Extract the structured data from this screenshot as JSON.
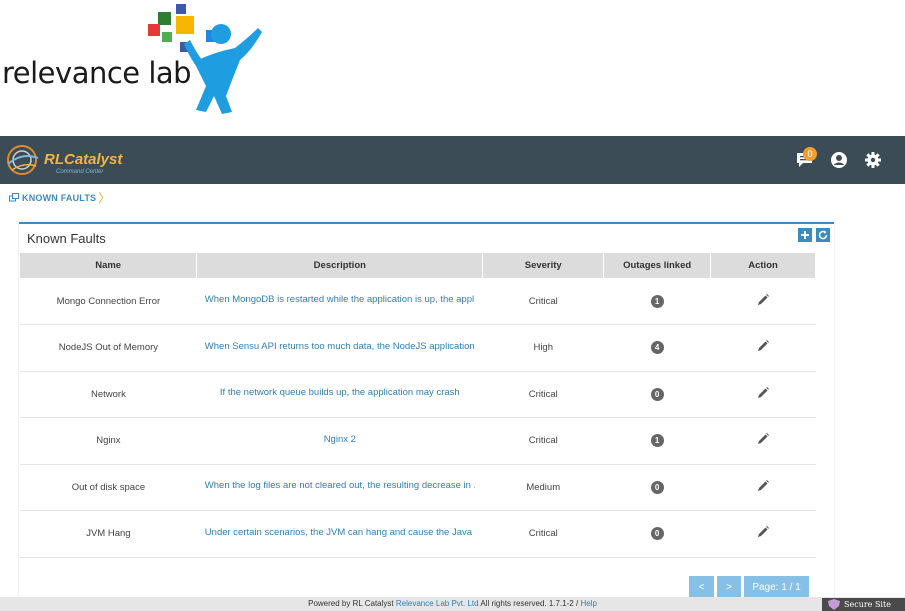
{
  "logo": {
    "text": "relevance lab"
  },
  "navbar": {
    "brand_name": "RLCatalyst",
    "brand_sub": "Command Center",
    "notification_count": "0"
  },
  "breadcrumb": {
    "label": "KNOWN FAULTS"
  },
  "panel": {
    "title": "Known Faults",
    "columns": [
      "Name",
      "Description",
      "Severity",
      "Outages linked",
      "Action"
    ],
    "rows": [
      {
        "name": "Mongo Connection Error",
        "description": "When MongoDB is restarted while the application is up, the appl...",
        "severity": "Critical",
        "outages": "1"
      },
      {
        "name": "NodeJS Out of Memory",
        "description": "When Sensu API returns too much data, the NodeJS application...",
        "severity": "High",
        "outages": "4"
      },
      {
        "name": "Network",
        "description": "If the network queue builds up, the application may crash",
        "severity": "Critical",
        "outages": "0"
      },
      {
        "name": "Nginx",
        "description": "Nginx 2",
        "severity": "Critical",
        "outages": "1"
      },
      {
        "name": "Out of disk space",
        "description": "When the log files are not cleared out, the resulting decrease in ...",
        "severity": "Medium",
        "outages": "0"
      },
      {
        "name": "JVM Hang",
        "description": "Under certain scenarios, the JVM can hang and cause the Java ...",
        "severity": "Critical",
        "outages": "0"
      }
    ]
  },
  "pagination": {
    "prev": "<",
    "next": ">",
    "page": "Page: 1 / 1"
  },
  "footer": {
    "prefix": "Powered by RL Catalyst",
    "company": "Relevance Lab Pvt. Ltd",
    "rights": "All rights reserved. 1.7.1-2 /",
    "help": "Help"
  },
  "secure_badge": "Secure Site",
  "colors": {
    "navbar": "#3c4c57",
    "accent": "#3a8bbf",
    "badge": "#f0a030"
  }
}
